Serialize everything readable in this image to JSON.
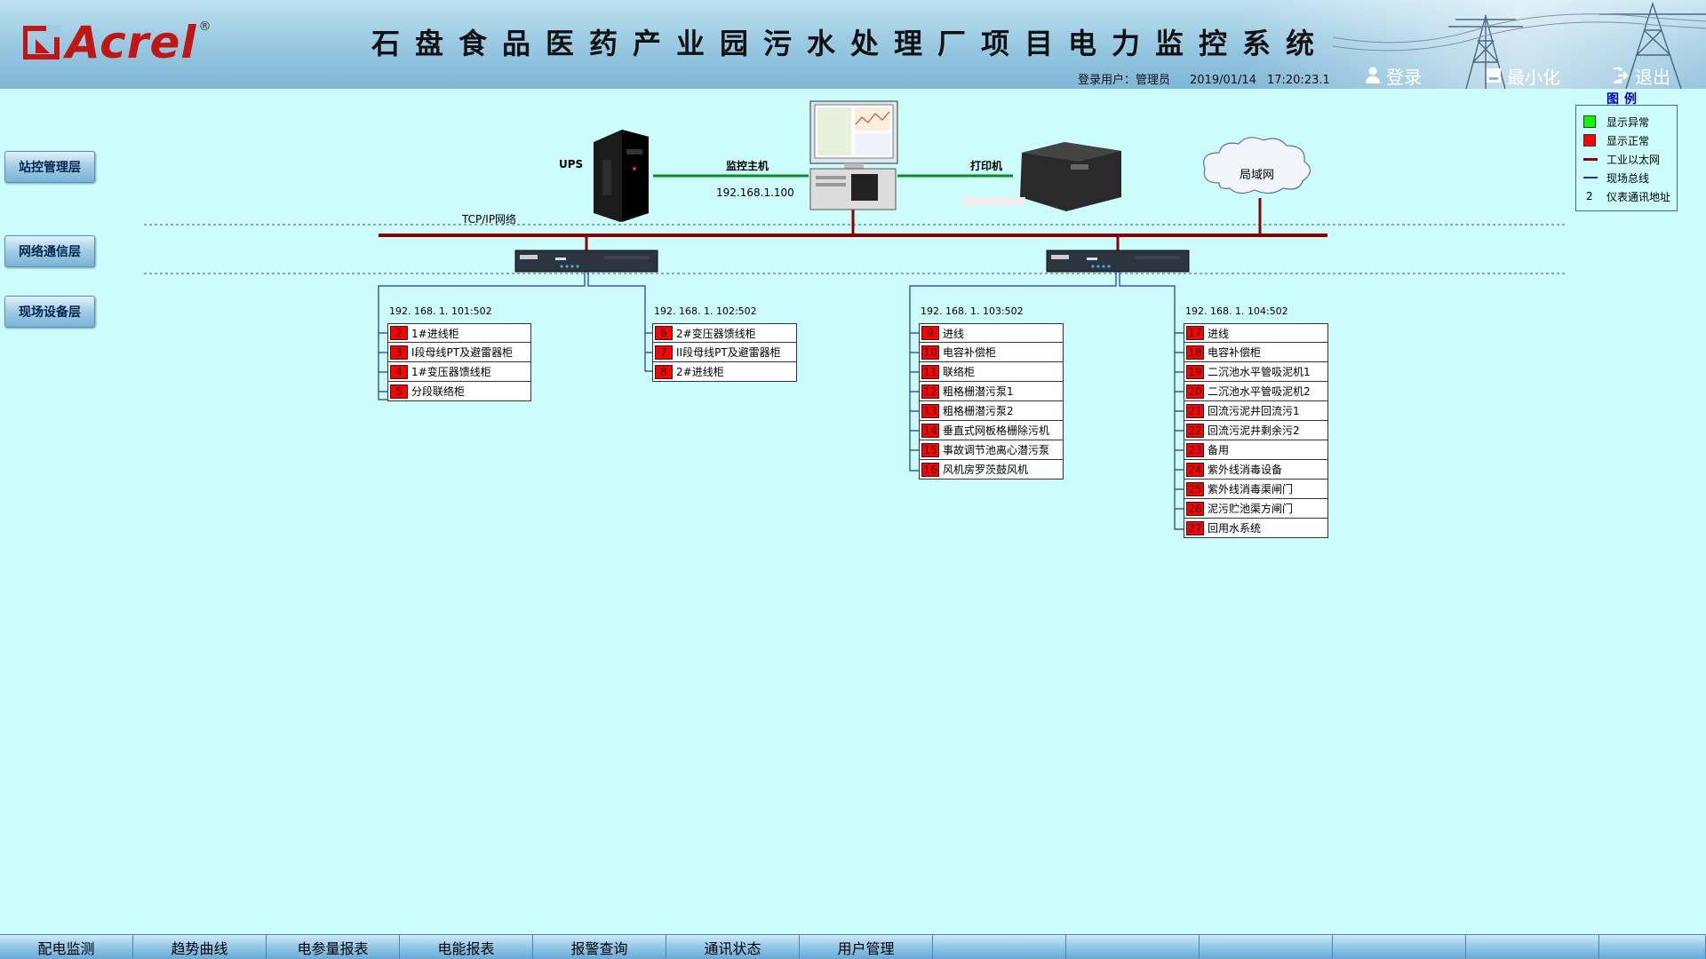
{
  "header": {
    "logo_text": "Acrel",
    "logo_reg": "®",
    "title": "石盘食品医药产业园污水处理厂项目电力监控系统",
    "login_user_label": "登录用户：",
    "login_user": "管理员",
    "date": "2019/01/14",
    "time": "17:20:23.1",
    "login_button": "登录",
    "minimize_button": "最小化",
    "exit_button": "退出"
  },
  "layers": {
    "station": "站控管理层",
    "network": "网络通信层",
    "field": "现场设备层"
  },
  "legend": {
    "title": "图例",
    "items": [
      {
        "label": "显示异常",
        "color": "#00ff00"
      },
      {
        "label": "显示正常",
        "color": "#ff0000"
      },
      {
        "label": "工业以太网",
        "color": "#8b0000"
      },
      {
        "label": "现场总线",
        "color": "#2233aa"
      },
      {
        "label": "仪表通讯地址",
        "mark": "2"
      }
    ]
  },
  "topology": {
    "ups": "UPS",
    "host": "监控主机",
    "host_ip": "192.168.1.100",
    "printer": "打印机",
    "lan": "局域网",
    "tcp_label": "TCP/IP网络"
  },
  "groups": [
    {
      "ip": "192. 168. 1. 101:502",
      "devices": [
        {
          "num": "2",
          "name": "1#进线柜"
        },
        {
          "num": "3",
          "name": "I段母线PT及避雷器柜"
        },
        {
          "num": "4",
          "name": "1#变压器馈线柜"
        },
        {
          "num": "5",
          "name": "分段联络柜"
        }
      ]
    },
    {
      "ip": "192. 168. 1. 102:502",
      "devices": [
        {
          "num": "6",
          "name": "2#变压器馈线柜"
        },
        {
          "num": "7",
          "name": "II段母线PT及避雷器柜"
        },
        {
          "num": "8",
          "name": "2#进线柜"
        }
      ]
    },
    {
      "ip": "192. 168. 1. 103:502",
      "devices": [
        {
          "num": "9",
          "name": "进线"
        },
        {
          "num": "10",
          "name": "电容补偿柜"
        },
        {
          "num": "11",
          "name": "联络柜"
        },
        {
          "num": "12",
          "name": "粗格栅潜污泵1"
        },
        {
          "num": "13",
          "name": "粗格栅潜污泵2"
        },
        {
          "num": "14",
          "name": "垂直式网板格栅除污机"
        },
        {
          "num": "15",
          "name": "事故调节池离心潜污泵"
        },
        {
          "num": "16",
          "name": "风机房罗茨鼓风机"
        }
      ]
    },
    {
      "ip": "192. 168. 1. 104:502",
      "devices": [
        {
          "num": "17",
          "name": "进线"
        },
        {
          "num": "18",
          "name": "电容补偿柜"
        },
        {
          "num": "19",
          "name": "二沉池水平管吸泥机1"
        },
        {
          "num": "20",
          "name": "二沉池水平管吸泥机2"
        },
        {
          "num": "21",
          "name": "回流污泥井回流污1"
        },
        {
          "num": "22",
          "name": "回流污泥井剩余污2"
        },
        {
          "num": "23",
          "name": "备用"
        },
        {
          "num": "24",
          "name": "紫外线消毒设备"
        },
        {
          "num": "25",
          "name": "紫外线消毒渠闸门"
        },
        {
          "num": "26",
          "name": "泥污贮池渠方闸门"
        },
        {
          "num": "27",
          "name": "回用水系统"
        }
      ]
    }
  ],
  "bottom_nav": [
    "配电监测",
    "趋势曲线",
    "电参量报表",
    "电能报表",
    "报警查询",
    "通讯状态",
    "用户管理",
    "",
    "",
    "",
    "",
    "",
    ""
  ],
  "colors": {
    "background": "#ccfcfc",
    "ethernet": "#8b0000",
    "fieldbus": "#2233aa",
    "host_link": "#0a8a2a",
    "status_normal": "#ff0000",
    "status_abnormal": "#00ff00"
  }
}
